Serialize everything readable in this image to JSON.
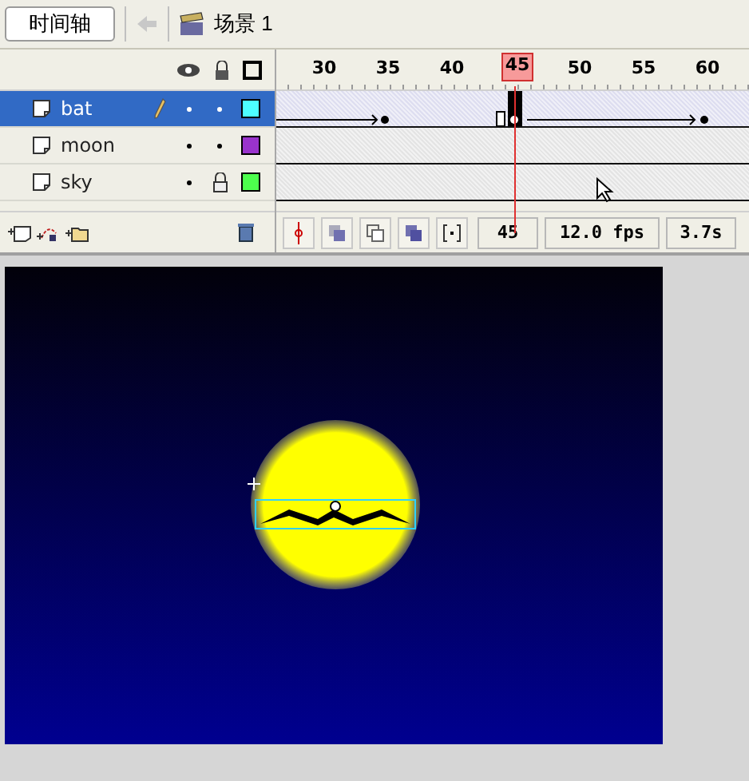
{
  "toolbar": {
    "timeline_button": "时间轴",
    "scene_label": "场景 1"
  },
  "ruler": [
    {
      "label": "30",
      "selected": false
    },
    {
      "label": "35",
      "selected": false
    },
    {
      "label": "40",
      "selected": false
    },
    {
      "label": "45",
      "selected": true
    },
    {
      "label": "50",
      "selected": false
    },
    {
      "label": "55",
      "selected": false
    },
    {
      "label": "60",
      "selected": false
    }
  ],
  "layers": [
    {
      "name": "bat",
      "selected": true,
      "editing": true,
      "visible": true,
      "locked": false,
      "color": "#4dffff"
    },
    {
      "name": "moon",
      "selected": false,
      "editing": false,
      "visible": true,
      "locked": false,
      "color": "#9933cc"
    },
    {
      "name": "sky",
      "selected": false,
      "editing": false,
      "visible": true,
      "locked": true,
      "color": "#4dff4d"
    }
  ],
  "status": {
    "current_frame": "45",
    "frame_rate": "12.0 fps",
    "elapsed": "3.7s"
  }
}
